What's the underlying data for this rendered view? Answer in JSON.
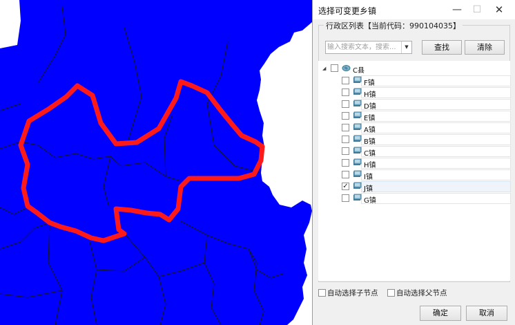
{
  "map": {
    "fill_color": "#0000ff",
    "boundary_color": "#1a1a1a",
    "highlight_color": "#ff1a1a"
  },
  "dialog": {
    "title": "选择可变更乡镇",
    "window_controls": {
      "minimize": "—",
      "maximize": "☐",
      "close": "✕"
    },
    "group_label": "行政区列表【当前代码：990104035】",
    "search": {
      "placeholder": "输入搜索文本，搜索...",
      "dropdown_icon": "chevron-down-icon"
    },
    "find_button": "查找",
    "clear_button": "清除",
    "tree": {
      "root": {
        "label": "C县",
        "checked": false,
        "expanded": true
      },
      "children": [
        {
          "label": "F镇",
          "checked": false
        },
        {
          "label": "H镇",
          "checked": false
        },
        {
          "label": "D镇",
          "checked": false
        },
        {
          "label": "E镇",
          "checked": false
        },
        {
          "label": "A镇",
          "checked": false
        },
        {
          "label": "B镇",
          "checked": false
        },
        {
          "label": "C镇",
          "checked": false
        },
        {
          "label": "H镇",
          "checked": false
        },
        {
          "label": "I镇",
          "checked": false
        },
        {
          "label": "J镇",
          "checked": true,
          "selected": true
        },
        {
          "label": "G镇",
          "checked": false
        }
      ]
    },
    "options": {
      "auto_select_children": {
        "label": "自动选择子节点",
        "checked": false
      },
      "auto_select_parent": {
        "label": "自动选择父节点",
        "checked": false
      }
    },
    "ok_button": "确定",
    "cancel_button": "取消"
  }
}
